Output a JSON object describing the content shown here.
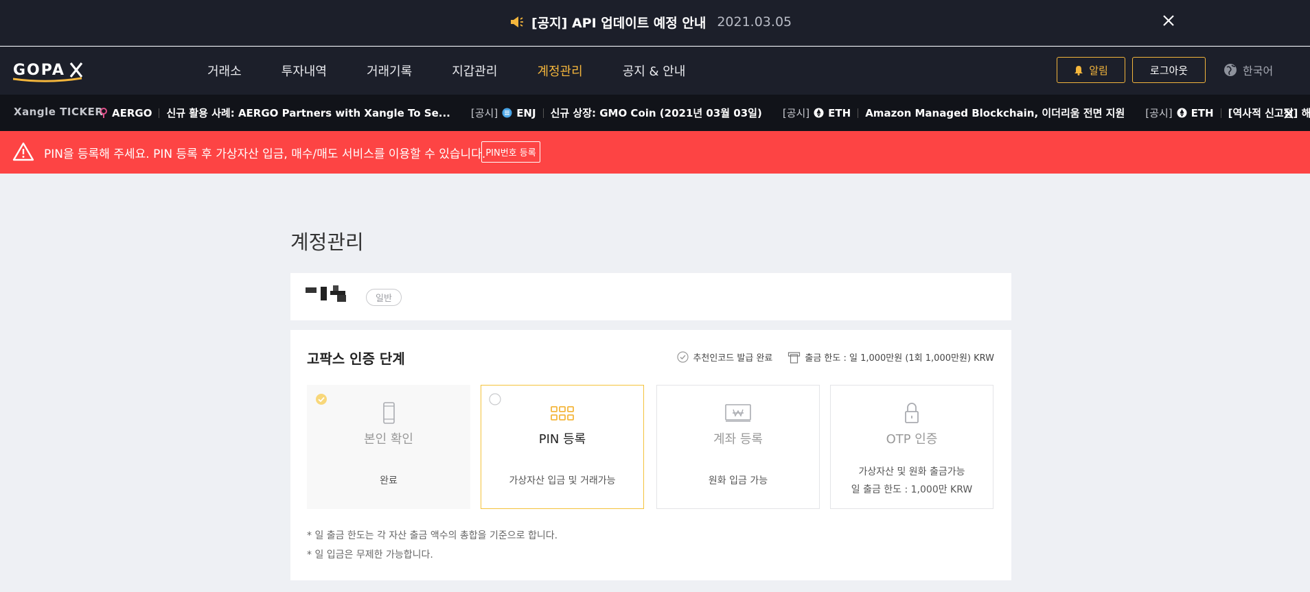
{
  "notice": {
    "title": "[공지] API 업데이트 예정 안내",
    "date": "2021.03.05"
  },
  "header": {
    "logo": "GOPAX",
    "nav": [
      {
        "label": "거래소",
        "active": false
      },
      {
        "label": "투자내역",
        "active": false
      },
      {
        "label": "거래기록",
        "active": false
      },
      {
        "label": "지갑관리",
        "active": false
      },
      {
        "label": "계정관리",
        "active": true
      },
      {
        "label": "공지 & 안내",
        "active": false
      }
    ],
    "alarm_label": "알림",
    "logout_label": "로그아웃",
    "language": "한국어"
  },
  "ticker": {
    "brand": "Xangle TICKER",
    "items": [
      {
        "tag": "",
        "coin": "AERGO",
        "title": "신규 활용 사례: AERGO Partners with Xangle To Se..."
      },
      {
        "tag": "[공시]",
        "coin": "ENJ",
        "title": "신규 상장: GMO Coin (2021년 03월 03일)"
      },
      {
        "tag": "[공시]",
        "coin": "ETH",
        "title": "Amazon Managed Blockchain, 이더리움 전면 지원"
      },
      {
        "tag": "[공시]",
        "coin": "ETH",
        "title": "[역사적 신고점] 해시레이트"
      }
    ]
  },
  "alert": {
    "message": "PIN을 등록해 주세요. PIN 등록 후 가상자산 입금, 매수/매도 서비스를 이용할 수 있습니다.",
    "button_label": "PIN번호 등록"
  },
  "page": {
    "title": "계정관리",
    "user_badge": "일반"
  },
  "auth": {
    "title": "고팍스 인증 단계",
    "referral_status": "추천인코드 발급 완료",
    "withdraw_limit": "출금 한도 : 일 1,000만원 (1회 1,000만원) KRW",
    "steps": [
      {
        "name": "본인 확인",
        "desc": "완료",
        "state": "done",
        "icon": "phone-icon"
      },
      {
        "name": "PIN 등록",
        "desc": "가상자산 입금 및 거래가능",
        "state": "current",
        "icon": "pin-grid-icon"
      },
      {
        "name": "계좌 등록",
        "desc": "원화 입금 가능",
        "state": "pending",
        "icon": "bank-account-icon"
      },
      {
        "name": "OTP 인증",
        "desc": "가상자산 및 원화 출금가능",
        "desc2": "일 출금 한도 : 1,000만 KRW",
        "state": "pending",
        "icon": "lock-icon"
      }
    ],
    "notes": [
      "* 일 출금 한도는 각 자산 출금 액수의 총합을 기준으로 합니다.",
      "* 일 입금은 무제한 가능합니다."
    ]
  },
  "colors": {
    "header_bg": "#1c1f2a",
    "accent": "#f4b63c",
    "alert_bg": "#fd4444",
    "page_bg": "#eef0f4"
  }
}
